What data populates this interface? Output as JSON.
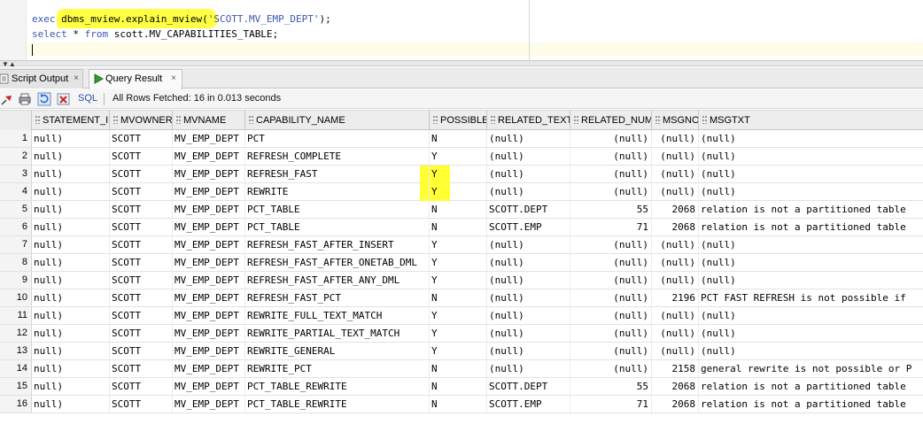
{
  "editor": {
    "line1": {
      "exec": "exec",
      "proc": "dbms_mview.explain_mview",
      "open": "(",
      "arg": "'SCOTT.MV_EMP_DEPT'",
      "close": ");"
    },
    "line2": {
      "select": "select",
      "star": " * ",
      "from": "from",
      "table": " scott.MV_CAPABILITIES_TABLE;"
    }
  },
  "tabs": [
    {
      "label": "Script Output",
      "close": "×"
    },
    {
      "label": "Query Result",
      "close": "×"
    }
  ],
  "toolbar": {
    "sql_label": "SQL",
    "status": "All Rows Fetched: 16 in 0.013 seconds"
  },
  "grid": {
    "columns": [
      "STATEMENT_ID",
      "MVOWNER",
      "MVNAME",
      "CAPABILITY_NAME",
      "POSSIBLE",
      "RELATED_TEXT",
      "RELATED_NUM",
      "MSGNO",
      "MSGTXT"
    ],
    "rows": [
      [
        "1",
        "null)",
        "SCOTT",
        "MV_EMP_DEPT",
        "PCT",
        "N",
        "(null)",
        "(null)",
        "(null)",
        "(null)"
      ],
      [
        "2",
        "null)",
        "SCOTT",
        "MV_EMP_DEPT",
        "REFRESH_COMPLETE",
        "Y",
        "(null)",
        "(null)",
        "(null)",
        "(null)"
      ],
      [
        "3",
        "null)",
        "SCOTT",
        "MV_EMP_DEPT",
        "REFRESH_FAST",
        "Y",
        "(null)",
        "(null)",
        "(null)",
        "(null)"
      ],
      [
        "4",
        "null)",
        "SCOTT",
        "MV_EMP_DEPT",
        "REWRITE",
        "Y",
        "(null)",
        "(null)",
        "(null)",
        "(null)"
      ],
      [
        "5",
        "null)",
        "SCOTT",
        "MV_EMP_DEPT",
        "PCT_TABLE",
        "N",
        "SCOTT.DEPT",
        "55",
        "2068",
        "relation is not a partitioned table"
      ],
      [
        "6",
        "null)",
        "SCOTT",
        "MV_EMP_DEPT",
        "PCT_TABLE",
        "N",
        "SCOTT.EMP",
        "71",
        "2068",
        "relation is not a partitioned table"
      ],
      [
        "7",
        "null)",
        "SCOTT",
        "MV_EMP_DEPT",
        "REFRESH_FAST_AFTER_INSERT",
        "Y",
        "(null)",
        "(null)",
        "(null)",
        "(null)"
      ],
      [
        "8",
        "null)",
        "SCOTT",
        "MV_EMP_DEPT",
        "REFRESH_FAST_AFTER_ONETAB_DML",
        "Y",
        "(null)",
        "(null)",
        "(null)",
        "(null)"
      ],
      [
        "9",
        "null)",
        "SCOTT",
        "MV_EMP_DEPT",
        "REFRESH_FAST_AFTER_ANY_DML",
        "Y",
        "(null)",
        "(null)",
        "(null)",
        "(null)"
      ],
      [
        "10",
        "null)",
        "SCOTT",
        "MV_EMP_DEPT",
        "REFRESH_FAST_PCT",
        "N",
        "(null)",
        "(null)",
        "2196",
        "PCT FAST REFRESH is not possible if"
      ],
      [
        "11",
        "null)",
        "SCOTT",
        "MV_EMP_DEPT",
        "REWRITE_FULL_TEXT_MATCH",
        "Y",
        "(null)",
        "(null)",
        "(null)",
        "(null)"
      ],
      [
        "12",
        "null)",
        "SCOTT",
        "MV_EMP_DEPT",
        "REWRITE_PARTIAL_TEXT_MATCH",
        "Y",
        "(null)",
        "(null)",
        "(null)",
        "(null)"
      ],
      [
        "13",
        "null)",
        "SCOTT",
        "MV_EMP_DEPT",
        "REWRITE_GENERAL",
        "Y",
        "(null)",
        "(null)",
        "(null)",
        "(null)"
      ],
      [
        "14",
        "null)",
        "SCOTT",
        "MV_EMP_DEPT",
        "REWRITE_PCT",
        "N",
        "(null)",
        "(null)",
        "2158",
        "general rewrite is not possible or P"
      ],
      [
        "15",
        "null)",
        "SCOTT",
        "MV_EMP_DEPT",
        "PCT_TABLE_REWRITE",
        "N",
        "SCOTT.DEPT",
        "55",
        "2068",
        "relation is not a partitioned table"
      ],
      [
        "16",
        "null)",
        "SCOTT",
        "MV_EMP_DEPT",
        "PCT_TABLE_REWRITE",
        "N",
        "SCOTT.EMP",
        "71",
        "2068",
        "relation is not a partitioned table"
      ]
    ],
    "highlighted_possible_rows": [
      3,
      4
    ]
  },
  "icons": [
    "pin-icon",
    "print-icon",
    "refresh-icon",
    "clear-icon",
    "run-icon",
    "script-icon"
  ],
  "colors": {
    "highlight": "#ffff33",
    "keyword": "#3b56b3",
    "run_green": "#2e9e2e",
    "pin_red": "#cc2222"
  }
}
